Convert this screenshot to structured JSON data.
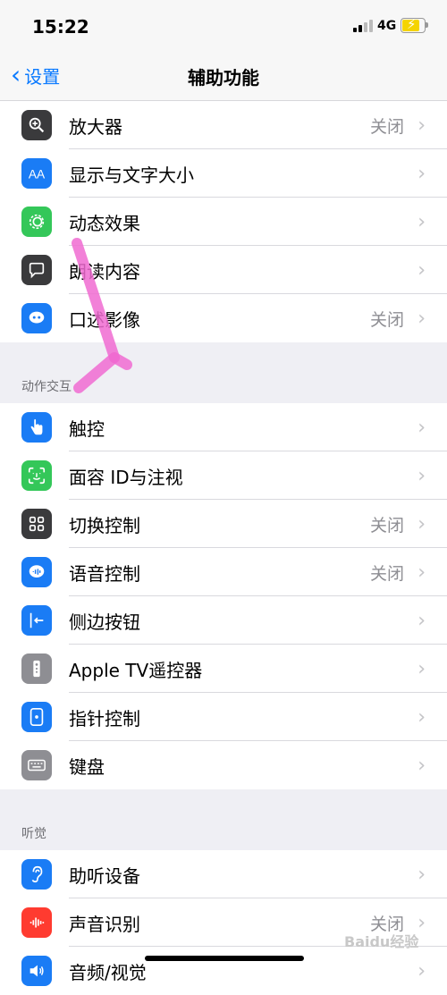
{
  "status_bar": {
    "time": "15:22",
    "network": "4G"
  },
  "nav": {
    "back_label": "设置",
    "title": "辅助功能"
  },
  "groups": [
    {
      "header": "",
      "items": [
        {
          "id": "zoom",
          "label": "放大器",
          "value": "关闭",
          "icon": "magnifier-icon",
          "color": "#3a3a3c"
        },
        {
          "id": "display-text-size",
          "label": "显示与文字大小",
          "value": "",
          "icon": "aa-text-icon",
          "color": "#1a7cf5"
        },
        {
          "id": "motion",
          "label": "动态效果",
          "value": "",
          "icon": "motion-icon",
          "color": "#34c759"
        },
        {
          "id": "spoken-content",
          "label": "朗读内容",
          "value": "",
          "icon": "speech-bubble-icon",
          "color": "#3a3a3c"
        },
        {
          "id": "audio-descriptions",
          "label": "口述影像",
          "value": "关闭",
          "icon": "quote-bubble-icon",
          "color": "#1a7cf5"
        }
      ]
    },
    {
      "header": "动作交互",
      "items": [
        {
          "id": "touch",
          "label": "触控",
          "value": "",
          "icon": "hand-pointer-icon",
          "color": "#1a7cf5"
        },
        {
          "id": "face-id",
          "label": "面容 ID与注视",
          "value": "",
          "icon": "face-id-icon",
          "color": "#34c759"
        },
        {
          "id": "switch-control",
          "label": "切换控制",
          "value": "关闭",
          "icon": "grid-icon",
          "color": "#3a3a3c"
        },
        {
          "id": "voice-control",
          "label": "语音控制",
          "value": "关闭",
          "icon": "voice-control-icon",
          "color": "#1a7cf5"
        },
        {
          "id": "side-button",
          "label": "侧边按钮",
          "value": "",
          "icon": "side-button-icon",
          "color": "#1a7cf5"
        },
        {
          "id": "apple-tv-remote",
          "label": "Apple TV遥控器",
          "value": "",
          "icon": "remote-icon",
          "color": "#8e8e93"
        },
        {
          "id": "pointer-control",
          "label": "指针控制",
          "value": "",
          "icon": "pointer-icon",
          "color": "#1a7cf5"
        },
        {
          "id": "keyboard",
          "label": "键盘",
          "value": "",
          "icon": "keyboard-icon",
          "color": "#8e8e93"
        }
      ]
    },
    {
      "header": "听觉",
      "items": [
        {
          "id": "hearing-devices",
          "label": "助听设备",
          "value": "",
          "icon": "ear-icon",
          "color": "#1a7cf5"
        },
        {
          "id": "sound-recognition",
          "label": "声音识别",
          "value": "关闭",
          "icon": "waveform-icon",
          "color": "#ff3b30"
        },
        {
          "id": "audio-visual",
          "label": "音频/视觉",
          "value": "",
          "icon": "speaker-icon",
          "color": "#1a7cf5"
        }
      ]
    }
  ],
  "chevron": "›",
  "watermark": "Baidu经验"
}
